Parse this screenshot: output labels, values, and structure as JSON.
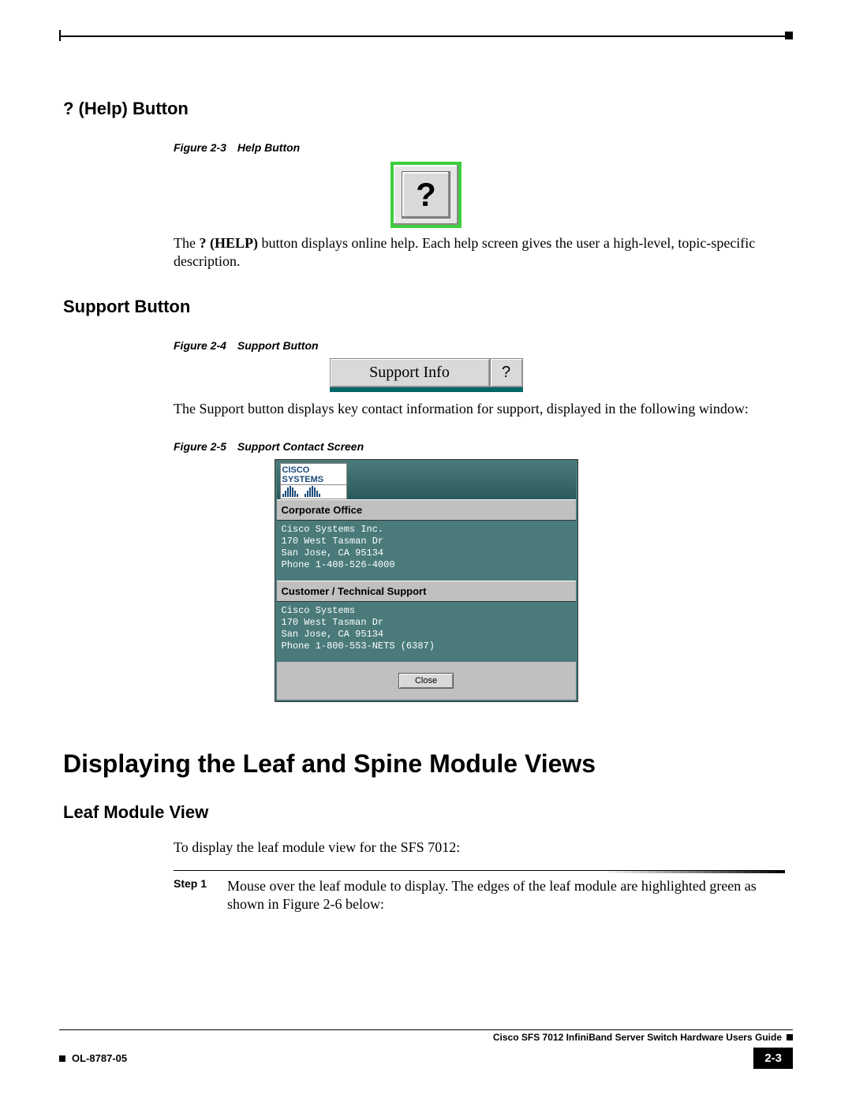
{
  "heading_help": "? (Help) Button",
  "fig23": {
    "num": "Figure 2-3",
    "title": "Help Button"
  },
  "help_glyph": "?",
  "help_para_prefix": "The ",
  "help_para_bold": "? (HELP)",
  "help_para_suffix": " button displays online help. Each help screen gives the user a high-level, topic-specific description.",
  "heading_support": "Support Button",
  "fig24": {
    "num": "Figure 2-4",
    "title": "Support Button"
  },
  "support_btn_label": "Support Info",
  "support_btn_icon": "?",
  "support_para": "The Support button displays key contact information for support, displayed in the following window:",
  "fig25": {
    "num": "Figure 2-5",
    "title": "Support Contact Screen"
  },
  "support_window": {
    "logo_text": "Cisco Systems",
    "corporate_head": "Corporate Office",
    "corporate_body": "Cisco Systems Inc.\n170 West Tasman Dr\nSan Jose, CA 95134\nPhone 1-408-526-4000",
    "tech_head": "Customer / Technical Support",
    "tech_body": "Cisco Systems\n170 West Tasman Dr\nSan Jose, CA 95134\nPhone 1-800-553-NETS (6387)",
    "close": "Close"
  },
  "section_title": "Displaying the Leaf and Spine Module Views",
  "heading_leaf": "Leaf Module View",
  "leaf_intro": "To display the leaf module view for the SFS 7012:",
  "step1_label": "Step 1",
  "step1_text": "Mouse over the leaf module to display. The edges of the leaf module are highlighted green as shown in Figure 2-6 below:",
  "footer": {
    "guide": "Cisco SFS 7012 InfiniBand Server Switch Hardware Users Guide",
    "docnum": "OL-8787-05",
    "pagenum": "2-3"
  }
}
